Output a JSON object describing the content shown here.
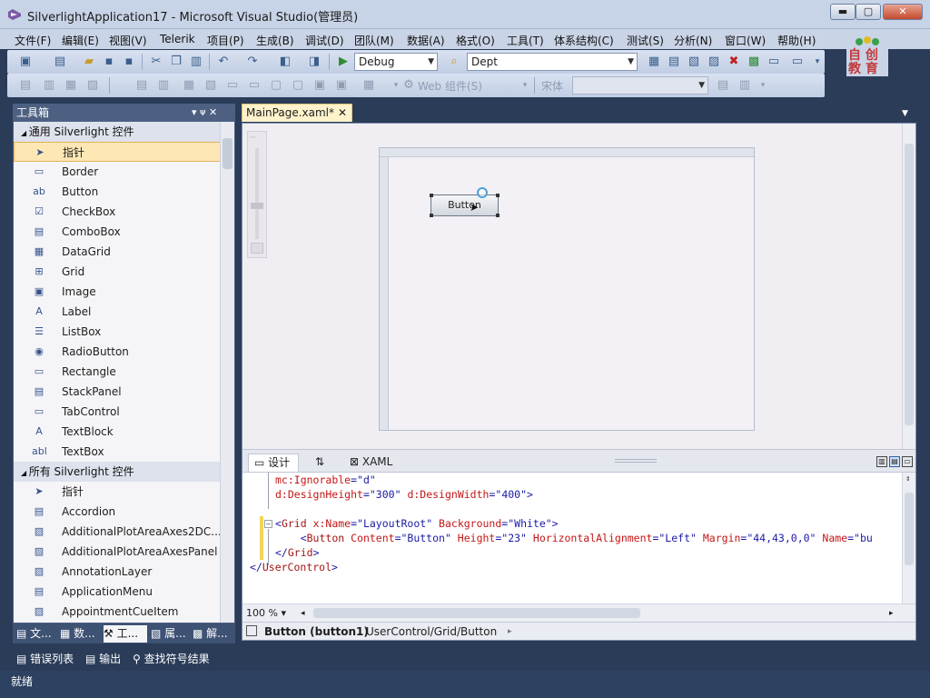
{
  "window": {
    "title": "SilverlightApplication17 - Microsoft Visual Studio(管理员)",
    "minimize": "▬",
    "restore": "▢",
    "close": "✕"
  },
  "menu": [
    "文件(F)",
    "编辑(E)",
    "视图(V)",
    "Telerik",
    "项目(P)",
    "生成(B)",
    "调试(D)",
    "团队(M)",
    "数据(A)",
    "格式(O)",
    "工具(T)",
    "体系结构(C)",
    "测试(S)",
    "分析(N)",
    "窗口(W)",
    "帮助(H)"
  ],
  "toolbar": {
    "config_value": "Debug",
    "find_value": "Dept",
    "bookmark_label": "Web 组件(S)",
    "font_label": "宋体"
  },
  "logo": {
    "text": "自 创 教 育"
  },
  "toolbox": {
    "title": "工具箱",
    "pin": "▾ ᴪ ✕",
    "group_common": "通用 Silverlight 控件",
    "common_items": [
      {
        "label": "指针",
        "icon": "pointer-icon",
        "glyph": "➤"
      },
      {
        "label": "Border",
        "icon": "border-icon",
        "glyph": "▭"
      },
      {
        "label": "Button",
        "icon": "button-icon",
        "glyph": "ab"
      },
      {
        "label": "CheckBox",
        "icon": "checkbox-icon",
        "glyph": "☑"
      },
      {
        "label": "ComboBox",
        "icon": "combobox-icon",
        "glyph": "▤"
      },
      {
        "label": "DataGrid",
        "icon": "datagrid-icon",
        "glyph": "▦"
      },
      {
        "label": "Grid",
        "icon": "grid-icon",
        "glyph": "⊞"
      },
      {
        "label": "Image",
        "icon": "image-icon",
        "glyph": "▣"
      },
      {
        "label": "Label",
        "icon": "label-icon",
        "glyph": "A"
      },
      {
        "label": "ListBox",
        "icon": "listbox-icon",
        "glyph": "☰"
      },
      {
        "label": "RadioButton",
        "icon": "radiobutton-icon",
        "glyph": "◉"
      },
      {
        "label": "Rectangle",
        "icon": "rectangle-icon",
        "glyph": "▭"
      },
      {
        "label": "StackPanel",
        "icon": "stackpanel-icon",
        "glyph": "▤"
      },
      {
        "label": "TabControl",
        "icon": "tabcontrol-icon",
        "glyph": "▭"
      },
      {
        "label": "TextBlock",
        "icon": "textblock-icon",
        "glyph": "A"
      },
      {
        "label": "TextBox",
        "icon": "textbox-icon",
        "glyph": "abl"
      }
    ],
    "group_all": "所有 Silverlight 控件",
    "all_items": [
      {
        "label": "指针",
        "icon": "pointer-icon",
        "glyph": "➤"
      },
      {
        "label": "Accordion",
        "icon": "accordion-icon",
        "glyph": "▤"
      },
      {
        "label": "AdditionalPlotAreaAxes2DC...",
        "icon": "control-icon",
        "glyph": "▨"
      },
      {
        "label": "AdditionalPlotAreaAxesPanel",
        "icon": "control-icon",
        "glyph": "▨"
      },
      {
        "label": "AnnotationLayer",
        "icon": "control-icon",
        "glyph": "▨"
      },
      {
        "label": "ApplicationMenu",
        "icon": "menu-icon",
        "glyph": "▤"
      },
      {
        "label": "AppointmentCueItem",
        "icon": "control-icon",
        "glyph": "▨"
      }
    ],
    "bottom_tabs": [
      "文...",
      "数...",
      "工...",
      "属...",
      "解..."
    ]
  },
  "document": {
    "tab_title": "MainPage.xaml*",
    "tab_close": "✕",
    "design_button_text": "Button",
    "split_tabs": [
      "设计",
      "⇅",
      "XAML"
    ],
    "xaml_lines": [
      {
        "parts": [
          {
            "t": "mc:",
            "c": "x-red"
          },
          {
            "t": "Ignorable",
            "c": "x-red"
          },
          {
            "t": "=\"",
            "c": "x-blue"
          },
          {
            "t": "d",
            "c": "x-blue"
          },
          {
            "t": "\"",
            "c": "x-blue"
          }
        ]
      },
      {
        "parts": [
          {
            "t": "d:DesignHeight",
            "c": "x-red"
          },
          {
            "t": "=\"",
            "c": "x-blue"
          },
          {
            "t": "300",
            "c": "x-blue"
          },
          {
            "t": "\" ",
            "c": "x-blue"
          },
          {
            "t": "d:DesignWidth",
            "c": "x-red"
          },
          {
            "t": "=\"",
            "c": "x-blue"
          },
          {
            "t": "400",
            "c": "x-blue"
          },
          {
            "t": "\">",
            "c": "x-blue"
          }
        ]
      },
      {
        "parts": []
      },
      {
        "parts": [
          {
            "t": "<",
            "c": "x-blue"
          },
          {
            "t": "Grid",
            "c": "x-brown"
          },
          {
            "t": " x:Name",
            "c": "x-red"
          },
          {
            "t": "=\"LayoutRoot\"",
            "c": "x-blue"
          },
          {
            "t": " Background",
            "c": "x-red"
          },
          {
            "t": "=\"White\">",
            "c": "x-blue"
          }
        ]
      },
      {
        "parts": [
          {
            "t": "    <",
            "c": "x-blue"
          },
          {
            "t": "Button",
            "c": "x-brown"
          },
          {
            "t": " Content",
            "c": "x-red"
          },
          {
            "t": "=\"Button\"",
            "c": "x-blue"
          },
          {
            "t": " Height",
            "c": "x-red"
          },
          {
            "t": "=\"23\"",
            "c": "x-blue"
          },
          {
            "t": " HorizontalAlignment",
            "c": "x-red"
          },
          {
            "t": "=\"Left\"",
            "c": "x-blue"
          },
          {
            "t": " Margin",
            "c": "x-red"
          },
          {
            "t": "=\"44,43,0,0\"",
            "c": "x-blue"
          },
          {
            "t": " Name",
            "c": "x-red"
          },
          {
            "t": "=\"bu",
            "c": "x-blue"
          }
        ]
      },
      {
        "parts": [
          {
            "t": "</",
            "c": "x-blue"
          },
          {
            "t": "Grid",
            "c": "x-brown"
          },
          {
            "t": ">",
            "c": "x-blue"
          }
        ]
      },
      {
        "parts": [
          {
            "t": "</",
            "c": "x-blue"
          },
          {
            "t": "UserControl",
            "c": "x-brown"
          },
          {
            "t": ">",
            "c": "x-blue"
          }
        ]
      }
    ],
    "zoom": "100 %",
    "breadcrumb_current": "Button (button1)",
    "breadcrumb_path": "UserControl/Grid/Button"
  },
  "output_tabs": [
    "错误列表",
    "输出",
    "查找符号结果"
  ],
  "status": "就绪"
}
